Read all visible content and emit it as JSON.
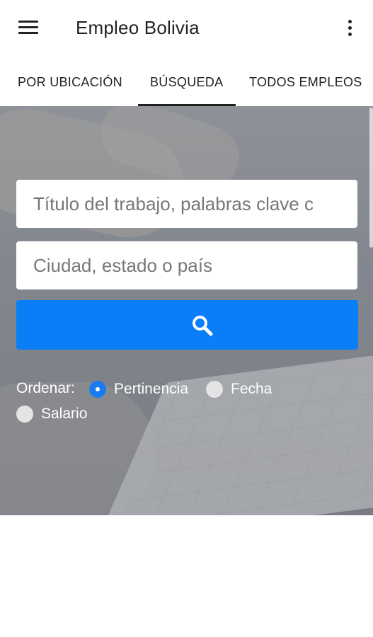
{
  "app": {
    "title": "Empleo Bolivia"
  },
  "tabs": [
    {
      "label": "POR UBICACIÓN",
      "active": false
    },
    {
      "label": "BÚSQUEDA",
      "active": true
    },
    {
      "label": "TODOS EMPLEOS",
      "active": false
    }
  ],
  "search": {
    "keywords_placeholder": "Título del trabajo, palabras clave o empresa",
    "keywords_visible": "Título del trabajo, palabras clave c",
    "location_placeholder": "Ciudad, estado o país",
    "button_icon": "search-icon",
    "button_color": "#0a7ef7"
  },
  "sort": {
    "label": "Ordenar:",
    "options": [
      {
        "label": "Pertinencia",
        "selected": true
      },
      {
        "label": "Fecha",
        "selected": false
      },
      {
        "label": "Salario",
        "selected": false
      }
    ]
  },
  "icons": {
    "menu": "menu-icon",
    "more": "more-vert-icon"
  }
}
